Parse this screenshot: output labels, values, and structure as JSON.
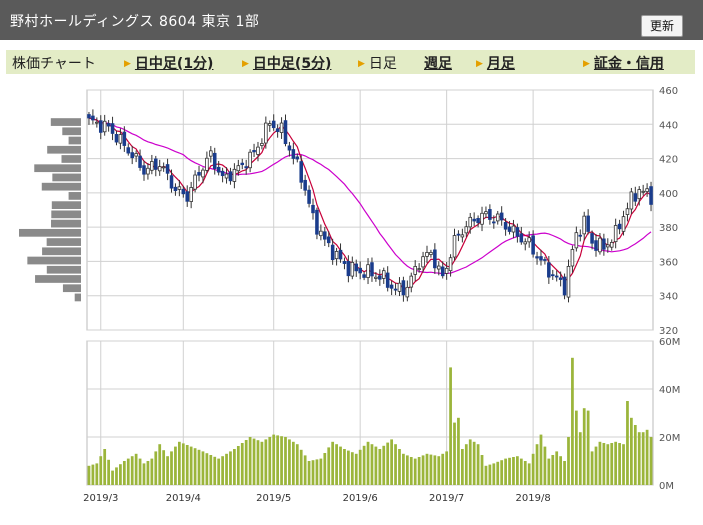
{
  "header": {
    "title": "野村ホールディングス  8604  東京 1部",
    "refresh_label": "更新"
  },
  "tabs": [
    {
      "label": "株価チャート",
      "link": false,
      "arrow": false
    },
    {
      "label": "日中足(1分)",
      "link": true,
      "arrow": true
    },
    {
      "label": "日中足(5分)",
      "link": true,
      "arrow": true
    },
    {
      "label": "日足",
      "link": false,
      "arrow": true
    },
    {
      "label": "週足",
      "link": true,
      "arrow": false
    },
    {
      "label": "月足",
      "link": true,
      "arrow": true
    },
    {
      "label": "証金・信用",
      "link": true,
      "arrow": true
    }
  ],
  "colors": {
    "up": "#ffffff",
    "down": "#1a3c8c",
    "ma_short": "#c8003a",
    "ma_long": "#cc00cc",
    "volume": "#9bb53b",
    "profile": "#8a8a8a",
    "grid": "#d0d0d0"
  },
  "chart_data": [
    {
      "type": "candlestick",
      "y_ticks": [
        "460",
        "440",
        "420",
        "400",
        "380",
        "360",
        "340",
        "320"
      ],
      "ylim": [
        320,
        460
      ],
      "x_labels": [
        "2019/3",
        "2019/4",
        "2019/5",
        "2019/6",
        "2019/7",
        "2019/8"
      ],
      "close_anchors": [
        [
          0,
          442
        ],
        [
          5,
          438
        ],
        [
          10,
          425
        ],
        [
          14,
          413
        ],
        [
          18,
          417
        ],
        [
          22,
          402
        ],
        [
          25,
          398
        ],
        [
          28,
          412
        ],
        [
          31,
          422
        ],
        [
          34,
          408
        ],
        [
          38,
          414
        ],
        [
          42,
          423
        ],
        [
          46,
          441
        ],
        [
          49,
          436
        ],
        [
          51,
          426
        ],
        [
          54,
          410
        ],
        [
          57,
          385
        ],
        [
          60,
          372
        ],
        [
          63,
          363
        ],
        [
          66,
          356
        ],
        [
          69,
          354
        ],
        [
          72,
          353
        ],
        [
          75,
          350
        ],
        [
          78,
          343
        ],
        [
          81,
          345
        ],
        [
          84,
          360
        ],
        [
          87,
          365
        ],
        [
          90,
          350
        ],
        [
          93,
          372
        ],
        [
          96,
          381
        ],
        [
          100,
          387
        ],
        [
          104,
          385
        ],
        [
          108,
          377
        ],
        [
          112,
          370
        ],
        [
          115,
          360
        ],
        [
          118,
          352
        ],
        [
          121,
          345
        ],
        [
          124,
          376
        ],
        [
          126,
          383
        ],
        [
          128,
          371
        ],
        [
          131,
          368
        ],
        [
          134,
          376
        ],
        [
          136,
          387
        ],
        [
          138,
          396
        ],
        [
          140,
          402
        ],
        [
          142,
          399
        ],
        [
          143,
          398
        ]
      ],
      "volume_ticks": [
        "60M",
        "40M",
        "20M",
        "0M"
      ],
      "volume_ylim": [
        0,
        60
      ],
      "volume_anchors": [
        [
          0,
          8
        ],
        [
          2,
          9
        ],
        [
          4,
          15
        ],
        [
          6,
          6
        ],
        [
          9,
          10
        ],
        [
          12,
          13
        ],
        [
          14,
          9
        ],
        [
          16,
          11
        ],
        [
          18,
          17
        ],
        [
          20,
          12
        ],
        [
          23,
          18
        ],
        [
          26,
          16
        ],
        [
          29,
          14
        ],
        [
          33,
          11
        ],
        [
          37,
          15
        ],
        [
          41,
          20
        ],
        [
          44,
          18
        ],
        [
          47,
          21
        ],
        [
          50,
          20
        ],
        [
          53,
          17
        ],
        [
          56,
          10
        ],
        [
          59,
          11
        ],
        [
          62,
          18
        ],
        [
          65,
          15
        ],
        [
          68,
          13
        ],
        [
          71,
          18
        ],
        [
          74,
          15
        ],
        [
          77,
          19
        ],
        [
          80,
          13
        ],
        [
          83,
          11
        ],
        [
          86,
          13
        ],
        [
          89,
          12
        ],
        [
          91,
          14
        ],
        [
          92,
          49
        ],
        [
          93,
          26
        ],
        [
          94,
          28
        ],
        [
          95,
          15
        ],
        [
          97,
          19
        ],
        [
          99,
          17
        ],
        [
          101,
          8
        ],
        [
          103,
          9
        ],
        [
          106,
          11
        ],
        [
          109,
          12
        ],
        [
          112,
          9
        ],
        [
          115,
          21
        ],
        [
          117,
          11
        ],
        [
          119,
          14
        ],
        [
          121,
          10
        ],
        [
          122,
          20
        ],
        [
          123,
          53
        ],
        [
          124,
          31
        ],
        [
          125,
          22
        ],
        [
          126,
          32
        ],
        [
          127,
          31
        ],
        [
          128,
          14
        ],
        [
          130,
          18
        ],
        [
          132,
          17
        ],
        [
          134,
          18
        ],
        [
          136,
          17
        ],
        [
          137,
          35
        ],
        [
          138,
          28
        ],
        [
          139,
          25
        ],
        [
          140,
          22
        ],
        [
          141,
          22
        ],
        [
          142,
          23
        ],
        [
          143,
          20
        ]
      ]
    }
  ]
}
